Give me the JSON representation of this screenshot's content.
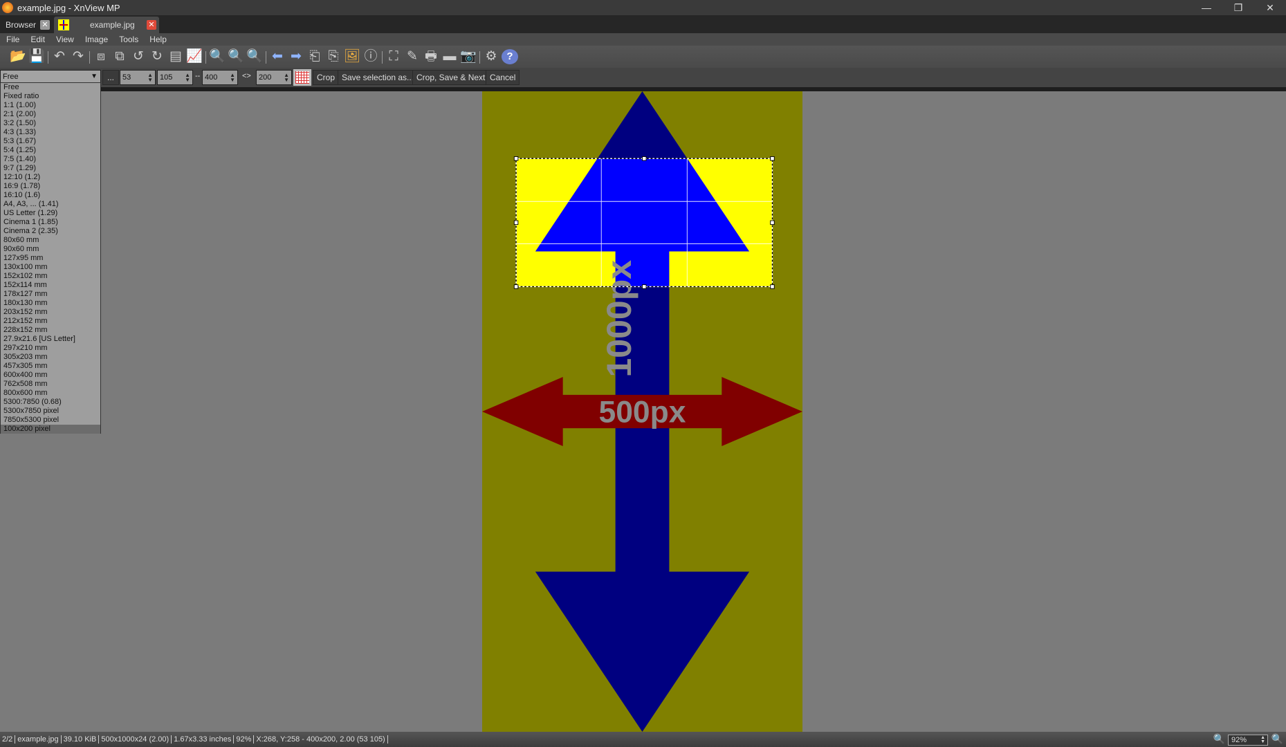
{
  "window": {
    "title": "example.jpg - XnView MP",
    "minimize": "—",
    "restore": "❐",
    "close": "✕"
  },
  "tabs": [
    {
      "label": "Browser",
      "close": "✕"
    },
    {
      "label": "example.jpg",
      "close": "✕"
    }
  ],
  "menu": [
    "File",
    "Edit",
    "View",
    "Image",
    "Tools",
    "Help"
  ],
  "toolbar": [
    {
      "icon": "browse-folders-icon",
      "glyph": "📂"
    },
    {
      "icon": "save-icon",
      "glyph": "💾"
    },
    {
      "icon": "undo-icon",
      "glyph": "↶"
    },
    {
      "icon": "redo-icon",
      "glyph": "↷"
    },
    {
      "icon": "crop-icon",
      "glyph": "⧈"
    },
    {
      "icon": "resize-icon",
      "glyph": "⧉"
    },
    {
      "icon": "rotate-left-icon",
      "glyph": "↺"
    },
    {
      "icon": "rotate-right-icon",
      "glyph": "↻"
    },
    {
      "icon": "adjust-icon",
      "glyph": "▤"
    },
    {
      "icon": "levels-icon",
      "glyph": "📈"
    },
    {
      "icon": "zoom-in-icon",
      "glyph": "🔍"
    },
    {
      "icon": "zoom-actual-icon",
      "glyph": "🔍"
    },
    {
      "icon": "zoom-out-icon",
      "glyph": "🔍"
    },
    {
      "icon": "previous-icon",
      "glyph": "⬅"
    },
    {
      "icon": "next-icon",
      "glyph": "➡"
    },
    {
      "icon": "first-page-icon",
      "glyph": "⎗"
    },
    {
      "icon": "last-page-icon",
      "glyph": "⎘"
    },
    {
      "icon": "slideshow-icon",
      "glyph": "🖼"
    },
    {
      "icon": "info-icon",
      "glyph": "ⓘ"
    },
    {
      "icon": "fullscreen-icon",
      "glyph": "⛶"
    },
    {
      "icon": "edit-text-icon",
      "glyph": "✎"
    },
    {
      "icon": "print-icon",
      "glyph": "🖶"
    },
    {
      "icon": "scan-icon",
      "glyph": "▬"
    },
    {
      "icon": "capture-icon",
      "glyph": "📷"
    },
    {
      "icon": "settings-icon",
      "glyph": "⚙"
    },
    {
      "icon": "help-icon",
      "glyph": "?"
    }
  ],
  "crop": {
    "ratio": "Free",
    "more": "...",
    "x": "53",
    "y": "105",
    "width": "400",
    "height": "200",
    "sep1": "--",
    "sep2": "<>",
    "crop": "Crop",
    "save_as": "Save selection as...",
    "crop_save_next": "Crop, Save & Next",
    "cancel": "Cancel"
  },
  "ratio_options": [
    "Free",
    "Fixed ratio",
    "1:1 (1.00)",
    "2:1 (2.00)",
    "3:2 (1.50)",
    "4:3 (1.33)",
    "5:3 (1.67)",
    "5:4 (1.25)",
    "7:5 (1.40)",
    "9:7 (1.29)",
    "12:10 (1.2)",
    "16:9 (1.78)",
    "16:10 (1.6)",
    "A4, A3, ... (1.41)",
    "US Letter (1.29)",
    "Cinema 1 (1.85)",
    "Cinema 2 (2.35)",
    "80x60 mm",
    "90x60 mm",
    "127x95 mm",
    "130x100 mm",
    "152x102 mm",
    "152x114 mm",
    "178x127 mm",
    "180x130 mm",
    "203x152 mm",
    "212x152 mm",
    "228x152 mm",
    "27.9x21.6 [US Letter]",
    "297x210 mm",
    "305x203 mm",
    "457x305 mm",
    "600x400 mm",
    "762x508 mm",
    "800x600 mm",
    "5300:7850 (0.68)",
    "5300x7850 pixel",
    "7850x5300 pixel",
    "100x200 pixel"
  ],
  "image": {
    "horizontal_label": "500px",
    "vertical_label": "1000px",
    "colors": {
      "bg": "#808000",
      "arrow_v": "#000080",
      "arrow_h": "#800000",
      "sel_bg": "#ffff00",
      "sel_arrow": "#0000ff"
    }
  },
  "status": [
    "2/2",
    "example.jpg",
    "39.10 KiB",
    "500x1000x24 (2.00)",
    "1.67x3.33 inches",
    "92%",
    "X:268, Y:258 - 400x200, 2.00 (53 105)"
  ],
  "zoom": {
    "value": "92%"
  }
}
